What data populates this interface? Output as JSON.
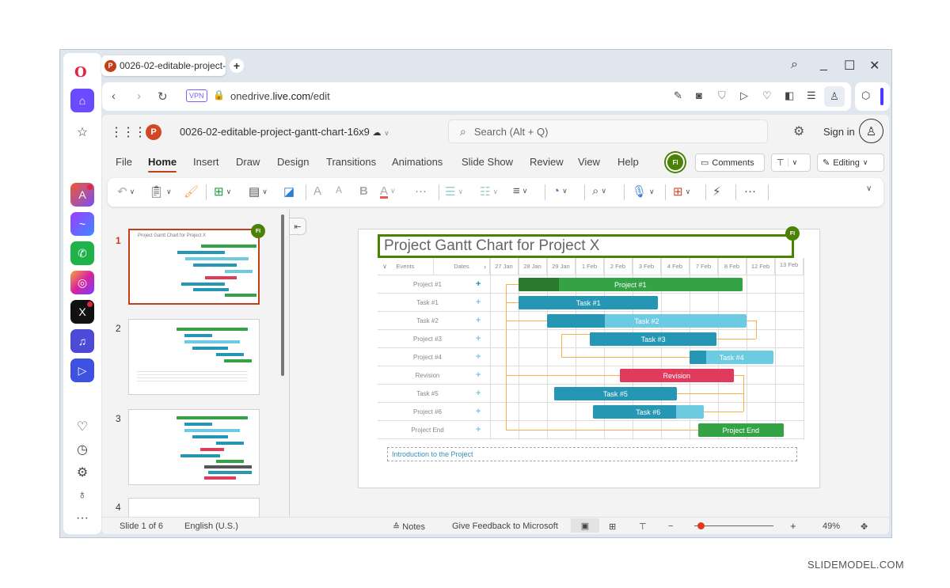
{
  "browser": {
    "tab_title": "0026-02-editable-project-",
    "new_tab_label": "+",
    "url_domain": "onedrive.",
    "url_host": "live.com",
    "url_path": "/edit",
    "vpn_label": "VPN",
    "window_controls": [
      "search-icon",
      "minimize-icon",
      "maximize-icon",
      "close-icon"
    ],
    "toolbar_icons": [
      "edit-snapshot-icon",
      "camera-icon",
      "shield-icon",
      "send-icon",
      "heart-icon",
      "battery-saver-icon",
      "easy-setup-icon",
      "profile-icon"
    ],
    "sidebar_apps": [
      "Opera Aria",
      "Messenger",
      "WhatsApp",
      "Instagram",
      "X",
      "Music",
      "Player"
    ],
    "sidebar_bottom": [
      "heart-icon",
      "history-icon",
      "settings-icon",
      "tips-icon",
      "more-icon"
    ]
  },
  "app": {
    "doc_title": "0026-02-editable-project-gantt-chart-16x9",
    "search_placeholder": "Search (Alt + Q)",
    "sign_in": "Sign in",
    "menu": [
      "File",
      "Home",
      "Insert",
      "Draw",
      "Design",
      "Transitions",
      "Animations",
      "Slide Show",
      "Review",
      "View",
      "Help"
    ],
    "active_menu": "Home",
    "user_initials": "FI",
    "comments_label": "Comments",
    "editing_label": "Editing"
  },
  "ribbon": {
    "font_size_up": "A",
    "font_size_down": "A",
    "bold": "B",
    "font_color": "A",
    "more": "···"
  },
  "thumbnails": [
    {
      "num": "1",
      "selected": true
    },
    {
      "num": "2",
      "selected": false
    },
    {
      "num": "3",
      "selected": false
    },
    {
      "num": "4",
      "selected": false
    }
  ],
  "slide": {
    "title": "Project Gantt Chart for Project X",
    "editor_badge": "FI",
    "footer_text": "Introduction to the Project",
    "gantt": {
      "header_events": "Events",
      "header_dates": "Dates",
      "dates": [
        "27 Jan",
        "28 Jan",
        "29 Jan",
        "1 Feb",
        "2 Feb",
        "3 Feb",
        "4 Feb",
        "7 Feb",
        "8 Feb",
        "12 Feb",
        "13 Feb"
      ],
      "rows": [
        {
          "name": "Project #1",
          "bar": "Project #1",
          "start": 1,
          "end": 8.85,
          "progress": 0.18,
          "color": "#33a345",
          "progress_color": "#2a7a2e",
          "light": false
        },
        {
          "name": "Task #1",
          "bar": "Task #1",
          "start": 1,
          "end": 5.9,
          "progress": 1.0,
          "color": "#2596b4",
          "progress_color": "#2596b4",
          "light": false
        },
        {
          "name": "Task #2",
          "bar": "Task #2",
          "start": 2,
          "end": 9,
          "progress": 0.29,
          "color": "#6ccbe0",
          "progress_color": "#2596b4",
          "light": true
        },
        {
          "name": "Project #3",
          "bar": "Task #3",
          "start": 3.5,
          "end": 7.95,
          "progress": 1.0,
          "color": "#2596b4",
          "progress_color": "#2596b4",
          "light": false
        },
        {
          "name": "Project #4",
          "bar": "Task #4",
          "start": 7,
          "end": 9.95,
          "progress": 0.2,
          "color": "#6ccbe0",
          "progress_color": "#2596b4",
          "light": true
        },
        {
          "name": "Revision",
          "bar": "Revision",
          "start": 4.55,
          "end": 8.55,
          "progress": 1.0,
          "color": "#e03a5d",
          "progress_color": "#e03a5d",
          "light": false
        },
        {
          "name": "Task #5",
          "bar": "Task #5",
          "start": 2.25,
          "end": 6.55,
          "progress": 1.0,
          "color": "#2596b4",
          "progress_color": "#2596b4",
          "light": false
        },
        {
          "name": "Project #6",
          "bar": "Task #6",
          "start": 3.6,
          "end": 7.5,
          "progress": 0.75,
          "color": "#6ccbe0",
          "progress_color": "#2596b4",
          "light": true
        },
        {
          "name": "Project End",
          "bar": "Project End",
          "start": 7.3,
          "end": 10.3,
          "progress": 1.0,
          "color": "#33a345",
          "progress_color": "#33a345",
          "light": false
        }
      ]
    }
  },
  "status": {
    "slide_counter": "Slide 1 of 6",
    "language": "English (U.S.)",
    "notes": "Notes",
    "feedback": "Give Feedback to Microsoft",
    "zoom_minus": "−",
    "zoom_plus": "+",
    "zoom_level": "49%"
  },
  "watermark": "SLIDEMODEL.COM"
}
